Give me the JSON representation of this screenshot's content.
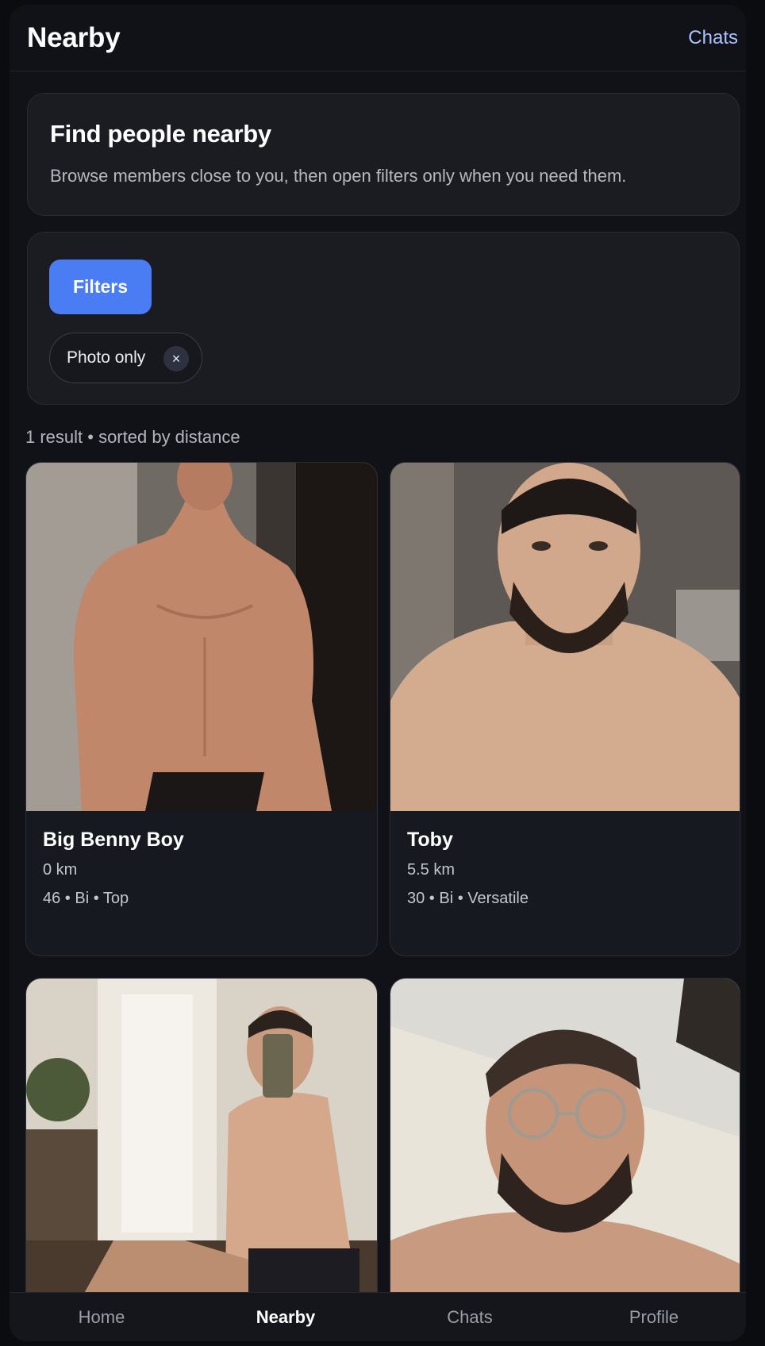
{
  "header": {
    "title": "Nearby",
    "chats_link": "Chats"
  },
  "intro": {
    "heading": "Find people nearby",
    "description": "Browse members close to you, then open filters only when you need them."
  },
  "filters": {
    "button_label": "Filters",
    "active_chips": [
      {
        "label": "Photo only",
        "remove_symbol": "×"
      }
    ]
  },
  "results_summary": "1 result • sorted by distance",
  "profiles": [
    {
      "name": "Big Benny Boy",
      "distance": "0 km",
      "details": "46 • Bi • Top"
    },
    {
      "name": "Toby",
      "distance": "5.5 km",
      "details": "30 • Bi • Versatile"
    },
    {
      "name": "",
      "distance": "",
      "details": ""
    },
    {
      "name": "",
      "distance": "",
      "details": ""
    }
  ],
  "bottom_nav": {
    "items": [
      {
        "label": "Home",
        "active": false
      },
      {
        "label": "Nearby",
        "active": true
      },
      {
        "label": "Chats",
        "active": false
      },
      {
        "label": "Profile",
        "active": false
      }
    ]
  }
}
